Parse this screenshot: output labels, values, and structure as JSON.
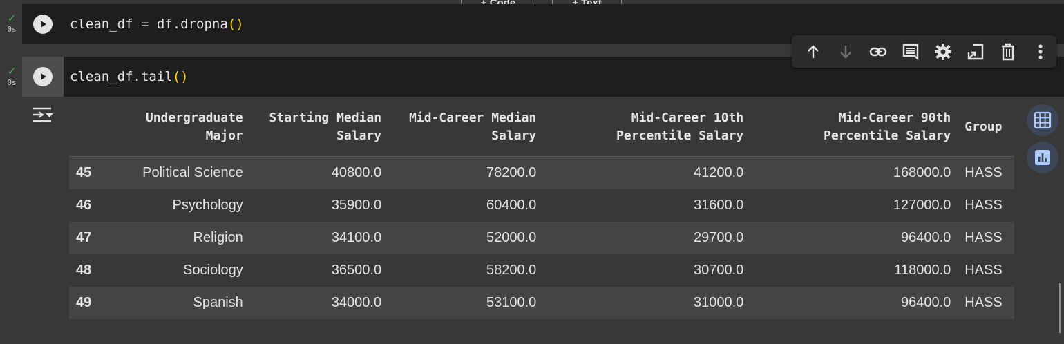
{
  "top_buttons": {
    "code_label": "+ Code",
    "text_label": "+ Text"
  },
  "cell1": {
    "status_time": "0s",
    "code_prefix": "clean_df = df.dropna",
    "code_parens": "()"
  },
  "cell2": {
    "status_time": "0s",
    "code_prefix": "clean_df.tail",
    "code_parens": "()"
  },
  "toolbar": {
    "icons": [
      "arrow-up-icon",
      "arrow-down-icon",
      "link-icon",
      "comment-icon",
      "gear-icon",
      "mirror-cell-icon",
      "delete-icon",
      "more-vert-icon"
    ]
  },
  "table": {
    "headers": [
      "",
      [
        "Undergraduate",
        "Major"
      ],
      [
        "Starting Median",
        "Salary"
      ],
      [
        "Mid-Career Median",
        "Salary"
      ],
      [
        "Mid-Career 10th",
        "Percentile Salary"
      ],
      [
        "Mid-Career 90th",
        "Percentile Salary"
      ],
      "Group"
    ],
    "rows": [
      [
        "45",
        "Political Science",
        "40800.0",
        "78200.0",
        "41200.0",
        "168000.0",
        "HASS"
      ],
      [
        "46",
        "Psychology",
        "35900.0",
        "60400.0",
        "31600.0",
        "127000.0",
        "HASS"
      ],
      [
        "47",
        "Religion",
        "34100.0",
        "52000.0",
        "29700.0",
        "96400.0",
        "HASS"
      ],
      [
        "48",
        "Sociology",
        "36500.0",
        "58200.0",
        "30700.0",
        "118000.0",
        "HASS"
      ],
      [
        "49",
        "Spanish",
        "34000.0",
        "53100.0",
        "31000.0",
        "96400.0",
        "HASS"
      ]
    ]
  },
  "colors": {
    "accent_check": "#4caf50",
    "paren": "#ffd700",
    "side_btn": "#3c4657",
    "side_icon": "#aecbfa"
  }
}
